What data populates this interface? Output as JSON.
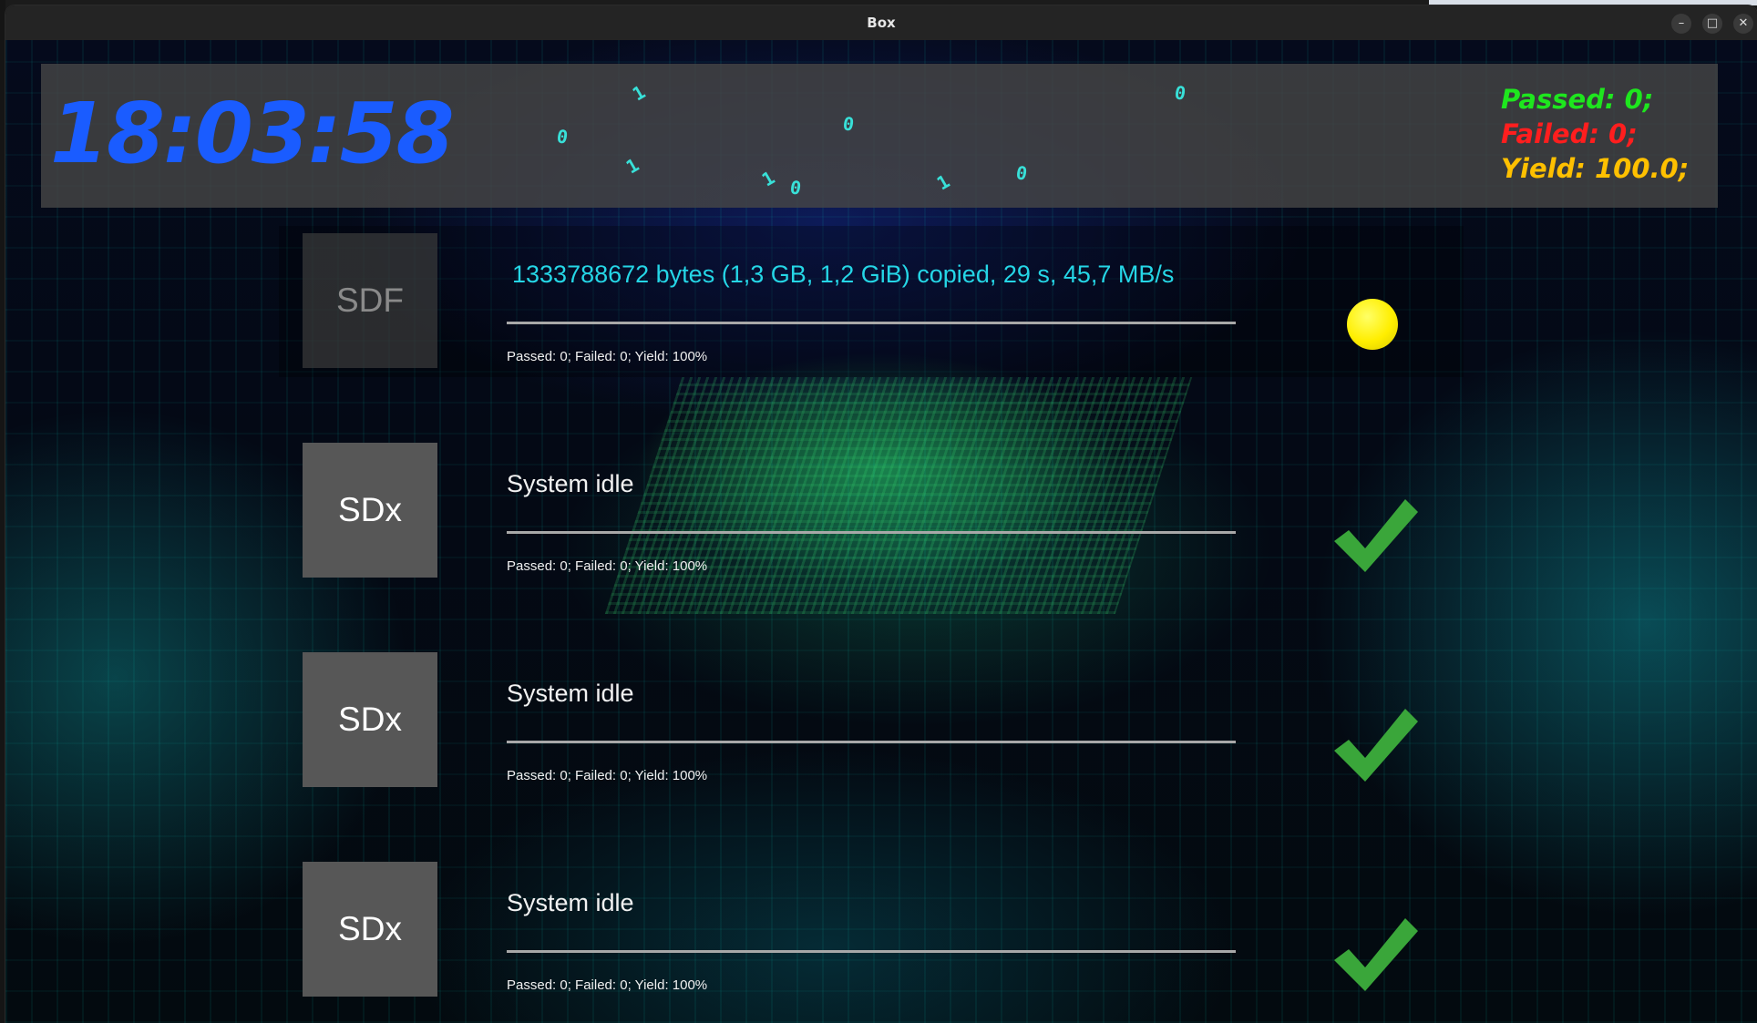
{
  "window": {
    "title": "Box",
    "controls": {
      "minimize": "–",
      "maximize": "□",
      "close": "✕"
    }
  },
  "header": {
    "clock": "18:03:58",
    "bits": [
      "1",
      "0",
      "1",
      "0",
      "1",
      "0",
      "1",
      "0",
      "0"
    ],
    "stats": {
      "passed": "Passed: 0;",
      "failed": "Failed: 0;",
      "yield": "Yield: 100.0;"
    }
  },
  "colors": {
    "clock": "#1a5cff",
    "passed": "#1ee61e",
    "failed": "#ff1e1e",
    "yield": "#ffc000",
    "active_status": "#25d6e6",
    "pending_dot": "#ffee00",
    "check": "#3aa63a"
  },
  "devices": [
    {
      "label": "SDF",
      "status": "1333788672 bytes (1,3 GB, 1,2 GiB) copied, 29 s, 45,7 MB/s",
      "stats": "Passed: 0; Failed: 0; Yield: 100%",
      "state": "in-progress",
      "icon": "yellow-dot-icon"
    },
    {
      "label": "SDx",
      "status": "System idle",
      "stats": "Passed: 0; Failed: 0; Yield: 100%",
      "state": "ok",
      "icon": "check-icon"
    },
    {
      "label": "SDx",
      "status": "System idle",
      "stats": "Passed: 0; Failed: 0; Yield: 100%",
      "state": "ok",
      "icon": "check-icon"
    },
    {
      "label": "SDx",
      "status": "System idle",
      "stats": "Passed: 0; Failed: 0; Yield: 100%",
      "state": "ok",
      "icon": "check-icon"
    }
  ]
}
